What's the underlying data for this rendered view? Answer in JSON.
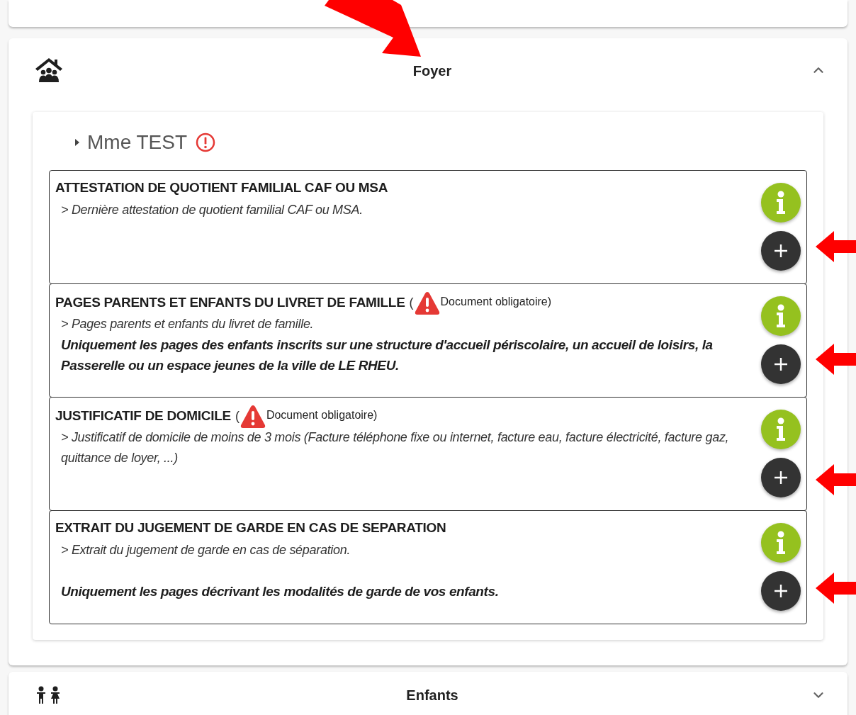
{
  "foyer": {
    "title": "Foyer",
    "expanded": true,
    "person": {
      "name": "Mme TEST",
      "expanded": false,
      "alert": true
    },
    "documents": [
      {
        "title": "ATTESTATION DE QUOTIENT FAMILIAL CAF OU MSA",
        "description": "> Dernière attestation de quotient familial CAF ou MSA."
      },
      {
        "title": "PAGES PARENTS ET ENFANTS DU LIVRET DE FAMILLE",
        "required": {
          "prefix": "(",
          "label": "Document obligatoire)"
        },
        "description": "> Pages parents et enfants du livret de famille.",
        "note": "Uniquement les pages des enfants inscrits sur une structure d'accueil périscolaire, un accueil de loisirs, la Passerelle ou un espace jeunes de la ville de LE RHEU.",
        "note_spaced": false
      },
      {
        "title": "JUSTIFICATIF DE DOMICILE",
        "required": {
          "prefix": "(",
          "label": "Document obligatoire)"
        },
        "description": "> Justificatif de domicile de moins de 3 mois (Facture téléphone fixe ou internet, facture eau, facture électricité, facture gaz, quittance de loyer, ...)"
      },
      {
        "title": "EXTRAIT DU JUGEMENT DE GARDE EN CAS DE SEPARATION",
        "description": "> Extrait du jugement de garde en cas de séparation.",
        "note": "Uniquement les pages décrivant les modalités de garde de vos enfants.",
        "note_spaced": true
      }
    ]
  },
  "enfants": {
    "title": "Enfants",
    "expanded": false
  }
}
